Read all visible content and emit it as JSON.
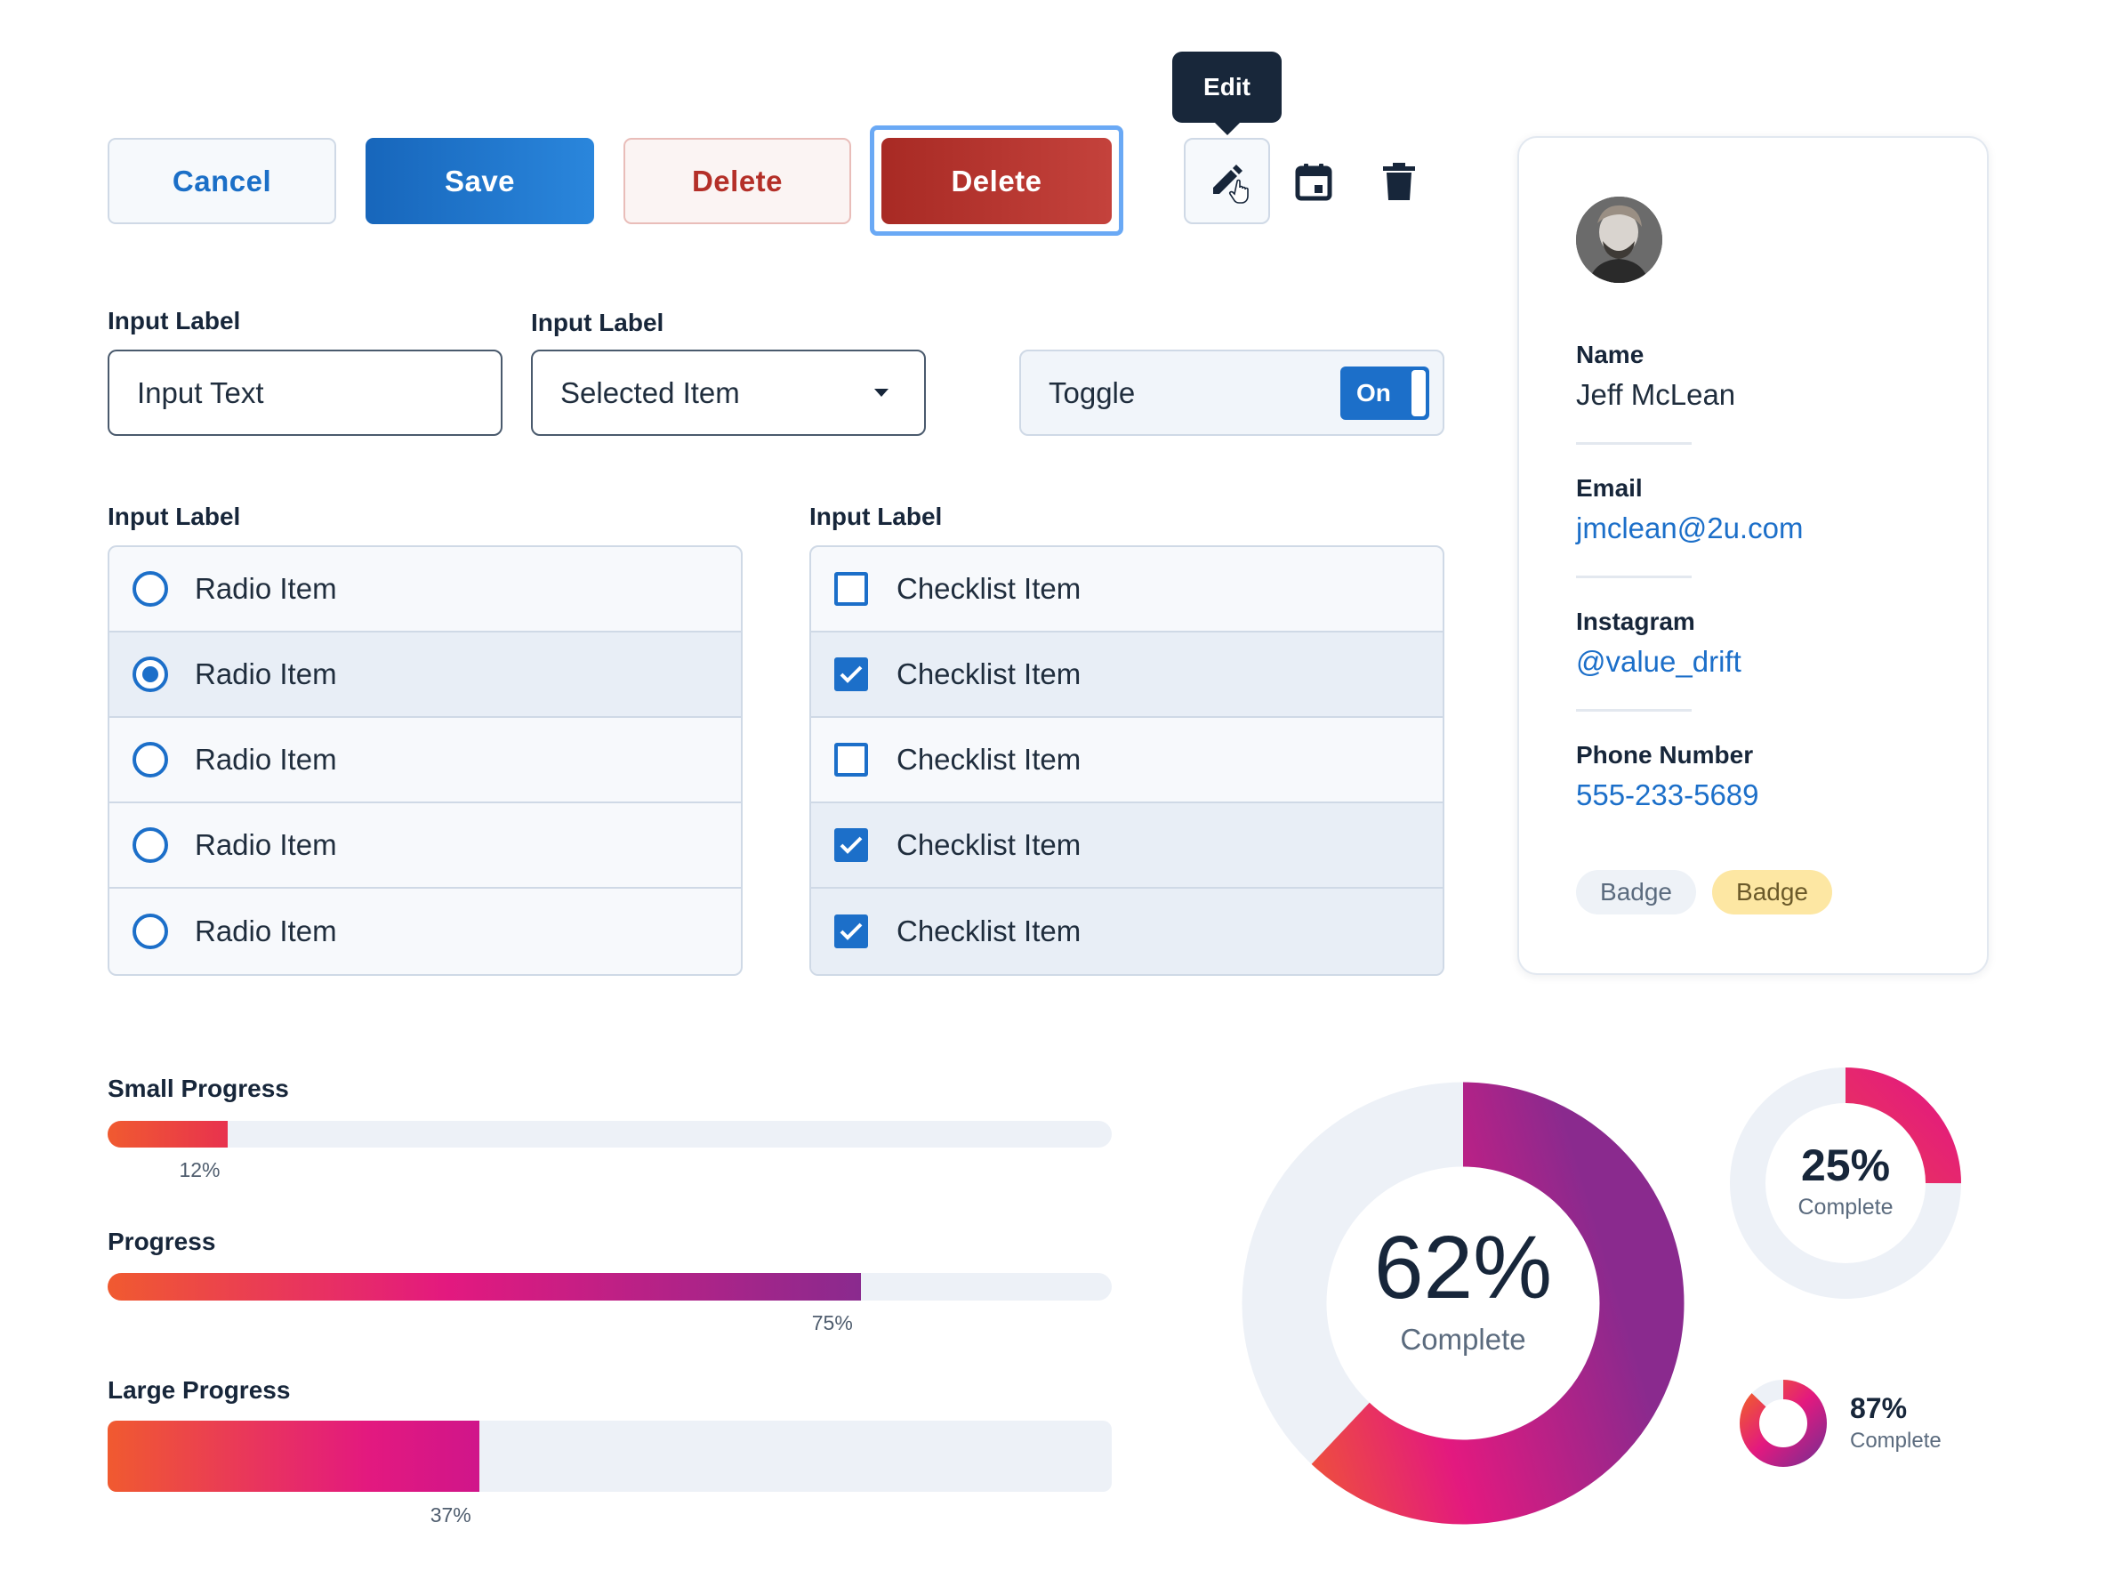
{
  "buttons": {
    "cancel": "Cancel",
    "save": "Save",
    "delete_outline": "Delete",
    "delete_solid": "Delete"
  },
  "tooltip": {
    "text": "Edit"
  },
  "icons": [
    "edit-pencil-icon",
    "calendar-icon",
    "trash-icon"
  ],
  "inputs": {
    "text_label": "Input Label",
    "text_value": "Input Text",
    "select_label": "Input Label",
    "select_value": "Selected Item",
    "toggle_label": "Toggle",
    "toggle_state": "On"
  },
  "radio_group": {
    "label": "Input Label",
    "items": [
      {
        "label": "Radio Item",
        "selected": false
      },
      {
        "label": "Radio Item",
        "selected": true
      },
      {
        "label": "Radio Item",
        "selected": false
      },
      {
        "label": "Radio Item",
        "selected": false
      },
      {
        "label": "Radio Item",
        "selected": false
      }
    ]
  },
  "checklist": {
    "label": "Input Label",
    "items": [
      {
        "label": "Checklist Item",
        "checked": false
      },
      {
        "label": "Checklist Item",
        "checked": true
      },
      {
        "label": "Checklist Item",
        "checked": false
      },
      {
        "label": "Checklist Item",
        "checked": true
      },
      {
        "label": "Checklist Item",
        "checked": true
      }
    ]
  },
  "profile": {
    "name_label": "Name",
    "name": "Jeff McLean",
    "email_label": "Email",
    "email": "jmclean@2u.com",
    "instagram_label": "Instagram",
    "instagram": "@value_drift",
    "phone_label": "Phone Number",
    "phone": "555-233-5689",
    "badges": [
      "Badge",
      "Badge"
    ]
  },
  "progress": {
    "small": {
      "label": "Small Progress",
      "value": 12,
      "text": "12%"
    },
    "medium": {
      "label": "Progress",
      "value": 75,
      "text": "75%"
    },
    "large": {
      "label": "Large Progress",
      "value": 37,
      "text": "37%"
    }
  },
  "donuts": {
    "large": {
      "value": 62,
      "text": "62%",
      "sub": "Complete"
    },
    "medium": {
      "value": 25,
      "text": "25%",
      "sub": "Complete"
    },
    "small": {
      "value": 87,
      "text": "87%",
      "sub": "Complete"
    }
  },
  "colors": {
    "primary": "#1c6fc9",
    "danger": "#b42f28",
    "gradient_start": "#f05a30",
    "gradient_mid": "#e3197f",
    "gradient_end": "#8a2a8e",
    "track": "#edf1f7"
  }
}
